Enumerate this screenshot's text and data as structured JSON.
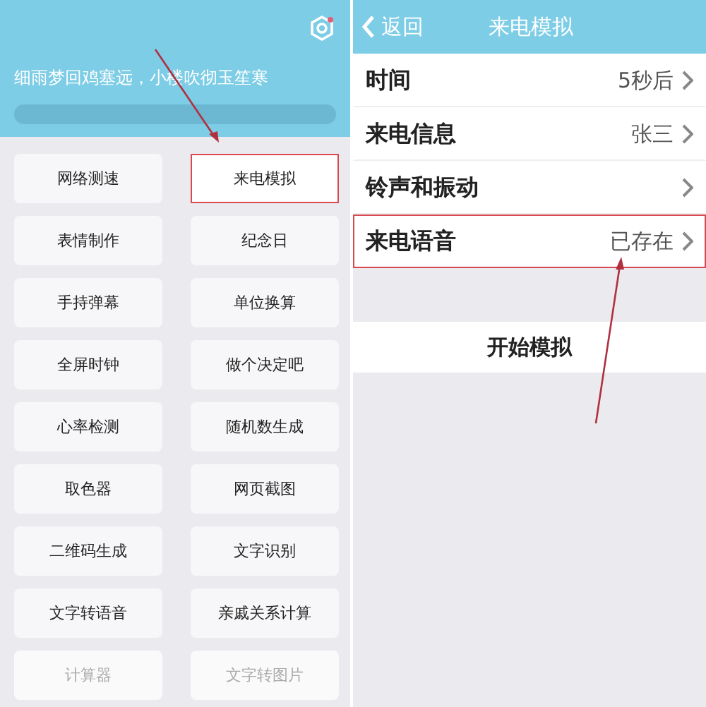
{
  "home": {
    "quote": "细雨梦回鸡塞远，小楼吹彻玉笙寒",
    "tools": [
      {
        "label": "网络测速",
        "highlighted": false,
        "dimmed": false
      },
      {
        "label": "来电模拟",
        "highlighted": true,
        "dimmed": false
      },
      {
        "label": "表情制作",
        "highlighted": false,
        "dimmed": false
      },
      {
        "label": "纪念日",
        "highlighted": false,
        "dimmed": false
      },
      {
        "label": "手持弹幕",
        "highlighted": false,
        "dimmed": false
      },
      {
        "label": "单位换算",
        "highlighted": false,
        "dimmed": false
      },
      {
        "label": "全屏时钟",
        "highlighted": false,
        "dimmed": false
      },
      {
        "label": "做个决定吧",
        "highlighted": false,
        "dimmed": false
      },
      {
        "label": "心率检测",
        "highlighted": false,
        "dimmed": false
      },
      {
        "label": "随机数生成",
        "highlighted": false,
        "dimmed": false
      },
      {
        "label": "取色器",
        "highlighted": false,
        "dimmed": false
      },
      {
        "label": "网页截图",
        "highlighted": false,
        "dimmed": false
      },
      {
        "label": "二维码生成",
        "highlighted": false,
        "dimmed": false
      },
      {
        "label": "文字识别",
        "highlighted": false,
        "dimmed": false
      },
      {
        "label": "文字转语音",
        "highlighted": false,
        "dimmed": false
      },
      {
        "label": "亲戚关系计算",
        "highlighted": false,
        "dimmed": false
      },
      {
        "label": "计算器",
        "highlighted": false,
        "dimmed": true
      },
      {
        "label": "文字转图片",
        "highlighted": false,
        "dimmed": true
      }
    ]
  },
  "call_sim": {
    "back": "返回",
    "title": "来电模拟",
    "settings": [
      {
        "label": "时间",
        "value": "5秒后",
        "highlighted": false
      },
      {
        "label": "来电信息",
        "value": "张三",
        "highlighted": false
      },
      {
        "label": "铃声和振动",
        "highlighted": false
      },
      {
        "label": "来电语音",
        "value": "已存在",
        "highlighted": true
      }
    ],
    "start_button": "开始模拟"
  }
}
